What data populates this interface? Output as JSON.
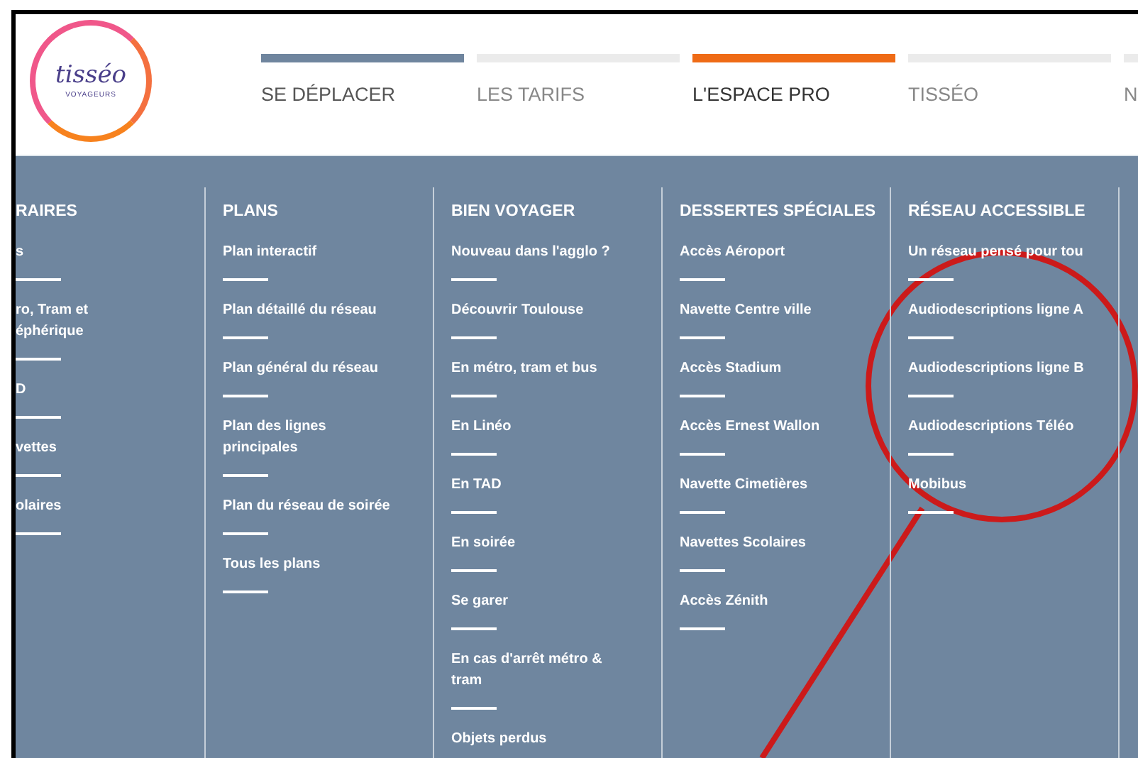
{
  "logo": {
    "name": "tisséo",
    "tagline": "VOYAGEURS"
  },
  "nav": [
    {
      "label": "SE DÉPLACER",
      "active": true,
      "selected": false
    },
    {
      "label": "LES TARIFS",
      "active": false,
      "selected": false
    },
    {
      "label": "L'ESPACE PRO",
      "active": false,
      "selected": true
    },
    {
      "label": "TISSÉO",
      "active": false,
      "selected": false
    },
    {
      "label": "N",
      "active": false,
      "selected": false
    }
  ],
  "menu": [
    {
      "heading": "RAIRES",
      "clipped": true,
      "items": [
        "s",
        "ro, Tram et éphérique",
        "D",
        "vettes",
        "olaires"
      ]
    },
    {
      "heading": "PLANS",
      "clipped": false,
      "items": [
        "Plan interactif",
        "Plan détaillé du réseau",
        "Plan général du réseau",
        "Plan des lignes principales",
        "Plan du réseau de soirée",
        "Tous les plans"
      ]
    },
    {
      "heading": "BIEN VOYAGER",
      "clipped": false,
      "items": [
        "Nouveau dans l'agglo ?",
        "Découvrir Toulouse",
        "En métro, tram et bus",
        "En Linéo",
        "En TAD",
        "En soirée",
        "Se garer",
        "En cas d'arrêt métro & tram",
        "Objets perdus"
      ]
    },
    {
      "heading": "DESSERTES SPÉCIALES",
      "clipped": false,
      "items": [
        "Accès Aéroport",
        "Navette Centre ville",
        "Accès Stadium",
        "Accès Ernest Wallon",
        "Navette Cimetières",
        "Navettes Scolaires",
        "Accès Zénith"
      ]
    },
    {
      "heading": "RÉSEAU ACCESSIBLE",
      "clipped": false,
      "items": [
        "Un réseau pensé pour tou",
        "Audiodescriptions ligne A",
        "Audiodescriptions ligne B",
        "Audiodescriptions Téléo",
        "Mobibus"
      ]
    }
  ]
}
